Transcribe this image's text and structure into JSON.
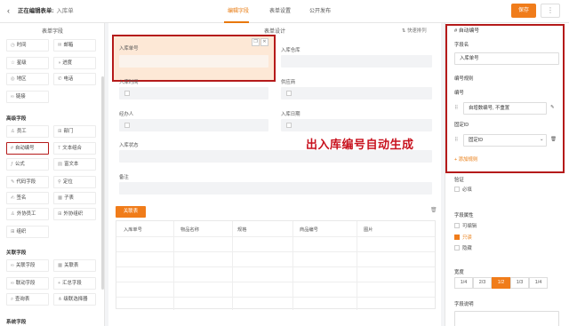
{
  "header": {
    "back_icon": "chevron-left-icon",
    "title": "正在编辑表单:",
    "form_name": "入库单",
    "tabs": [
      "编辑字段",
      "表单设置",
      "公开发布"
    ],
    "active_tab": 0,
    "save_label": "保存",
    "more_label": "⋮",
    "accent": "#f07c1a"
  },
  "left_panel": {
    "title": "表单字段",
    "basic_fields": [
      "时间",
      "邮箱",
      "星级",
      "进度",
      "地区",
      "电话",
      "链接"
    ],
    "advanced_title": "高级字段",
    "advanced_fields": [
      "员工",
      "部门",
      "自动编号",
      "文本组合",
      "公式",
      "富文本",
      "代码字段",
      "定位",
      "签名",
      "子表",
      "外协员工",
      "外协组织",
      "组织"
    ],
    "relation_title": "关联字段",
    "relation_fields": [
      "关联字段",
      "关联表",
      "联动字段",
      "汇总字段",
      "查询表",
      "级联选择器"
    ],
    "system_title": "系统字段"
  },
  "canvas": {
    "title": "表单设计",
    "sort_label": "快速排列",
    "fields": {
      "f1": "入库单号",
      "f2": "入库仓库",
      "f3": "入库时间",
      "f4": "供应商",
      "f5": "经办人",
      "f6": "入库日期",
      "f7": "入库状态",
      "f8": "备注"
    },
    "annotation": "出入库编号自动生成",
    "subtable_label": "关联表",
    "table_headers": [
      "入库单号",
      "物品名称",
      "规格",
      "商品编号",
      "图片"
    ]
  },
  "right_panel": {
    "header": "自动编号",
    "field_name_label": "字段名",
    "field_name_value": "入库单号",
    "rule_label": "编号规则",
    "number_label": "编号",
    "number_value": "自增数编号, 不重置",
    "custom_label": "固定ID",
    "custom_value": "固定ID",
    "add_rule": "+ 添加规则",
    "validate_label": "验证",
    "required_label": "必填",
    "attr_label": "字段属性",
    "attr_options": [
      "可编辑",
      "只读",
      "隐藏"
    ],
    "attr_selected": 1,
    "width_label": "宽度",
    "width_options": [
      "1/4",
      "2/3",
      "1/2",
      "1/3",
      "1/4"
    ],
    "width_selected": 2,
    "desc_label": "字段说明"
  }
}
